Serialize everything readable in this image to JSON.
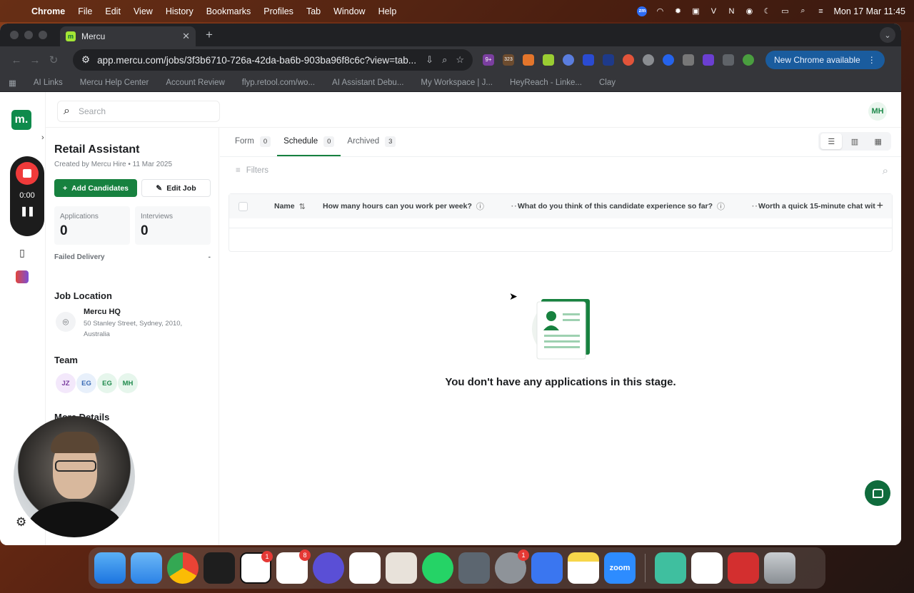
{
  "menubar": {
    "items": [
      "Chrome",
      "File",
      "Edit",
      "View",
      "History",
      "Bookmarks",
      "Profiles",
      "Tab",
      "Window",
      "Help"
    ],
    "clock": "Mon 17 Mar  11:45"
  },
  "browser": {
    "tab_title": "Mercu",
    "url": "app.mercu.com/jobs/3f3b6710-726a-42da-ba6b-903ba96f8c6c?view=tab...",
    "new_chrome": "New Chrome available",
    "ext_badges": [
      "9+",
      "323"
    ],
    "bookmarks": [
      "AI Links",
      "Mercu Help Center",
      "Account Review",
      "flyp.retool.com/wo...",
      "AI Assistant Debu...",
      "My Workspace | J...",
      "HeyReach - Linke...",
      "Clay"
    ]
  },
  "app": {
    "logo": "m.",
    "search_placeholder": "Search",
    "user_initials": "MH",
    "recorder_time": "0:00",
    "job": {
      "title": "Retail Assistant",
      "meta": "Created by Mercu Hire • 11 Mar 2025",
      "add_candidates": "Add Candidates",
      "edit_job": "Edit Job",
      "applications_label": "Applications",
      "applications_value": "0",
      "interviews_label": "Interviews",
      "interviews_value": "0",
      "failed_delivery": "Failed Delivery",
      "failed_value": "-"
    },
    "location": {
      "heading": "Job Location",
      "name": "Mercu HQ",
      "address": "50 Stanley Street, Sydney, 2010, Australia"
    },
    "team": {
      "heading": "Team",
      "members": [
        "JZ",
        "EG",
        "EG",
        "MH"
      ]
    },
    "more_details": "More Details",
    "tabs": [
      {
        "label": "Form",
        "count": "0"
      },
      {
        "label": "Schedule",
        "count": "0"
      },
      {
        "label": "Archived",
        "count": "3"
      }
    ],
    "filters_label": "Filters",
    "table_headers": [
      "Name",
      "How many hours can you work per week?",
      "What do you think of this candidate experience so far?",
      "Worth a quick 15-minute chat witl"
    ],
    "empty_message": "You don't have any applications in this stage."
  },
  "dock": {
    "badges": {
      "notion": "1",
      "slack": "8",
      "settings": "1"
    },
    "zoom_label": "zoom"
  },
  "colors": {
    "brand_green": "#17813f",
    "record_red": "#ef3a3a"
  }
}
